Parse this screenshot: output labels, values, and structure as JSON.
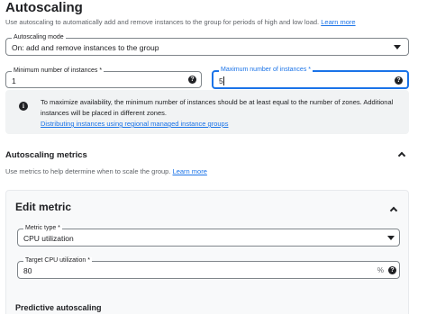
{
  "header": {
    "title": "Autoscaling",
    "description": "Use autoscaling to automatically add and remove instances to the group for periods of high and low load.",
    "learn_more": "Learn more"
  },
  "autoscaling_mode": {
    "label": "Autoscaling mode",
    "value": "On: add and remove instances to the group"
  },
  "min_instances": {
    "label": "Minimum number of instances *",
    "value": "1"
  },
  "max_instances": {
    "label": "Maximum number of instances *",
    "value": "5"
  },
  "info": {
    "text": "To maximize availability, the minimum number of instances should be at least equal to the number of zones. Additional instances will be placed in different zones.",
    "link": "Distributing instances using regional managed instance groups"
  },
  "metrics": {
    "title": "Autoscaling metrics",
    "description": "Use metrics to help determine when to scale the group.",
    "learn_more": "Learn more"
  },
  "edit_metric": {
    "title": "Edit metric",
    "metric_type_label": "Metric type *",
    "metric_type_value": "CPU utilization",
    "target_label": "Target CPU utilization *",
    "target_value": "80",
    "target_suffix": "%",
    "predictive_title": "Predictive autoscaling"
  },
  "icons": {
    "help": "?",
    "info": "i"
  },
  "colors": {
    "accent": "#1a73e8",
    "info_bg": "#f1f3f4"
  }
}
